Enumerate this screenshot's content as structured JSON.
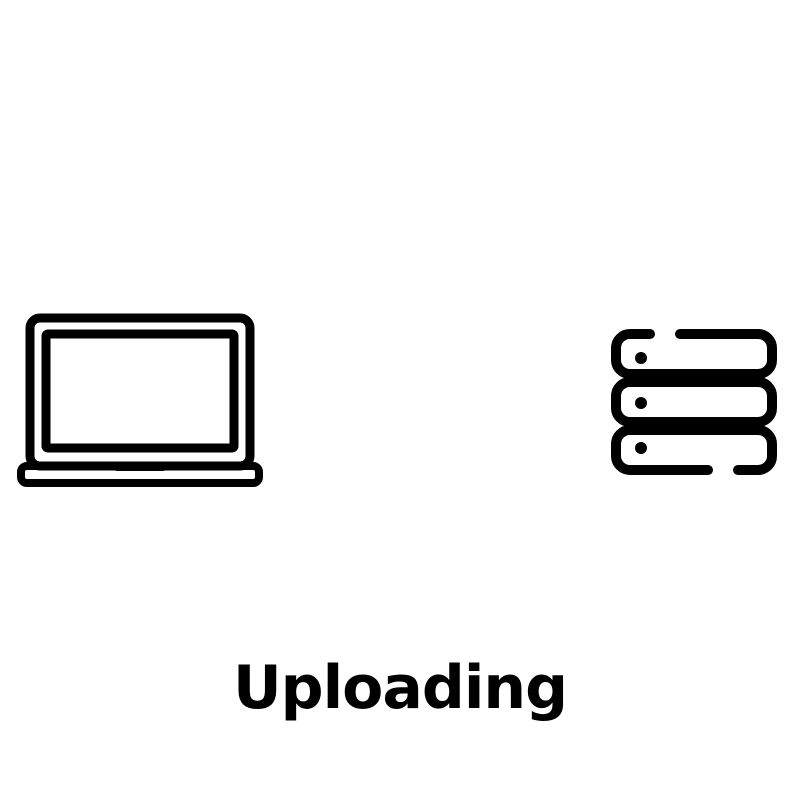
{
  "upload": {
    "status_label": "Uploading",
    "source_icon": "laptop-icon",
    "destination_icon": "server-icon"
  },
  "colors": {
    "background": "#ffffff",
    "foreground": "#000000"
  }
}
